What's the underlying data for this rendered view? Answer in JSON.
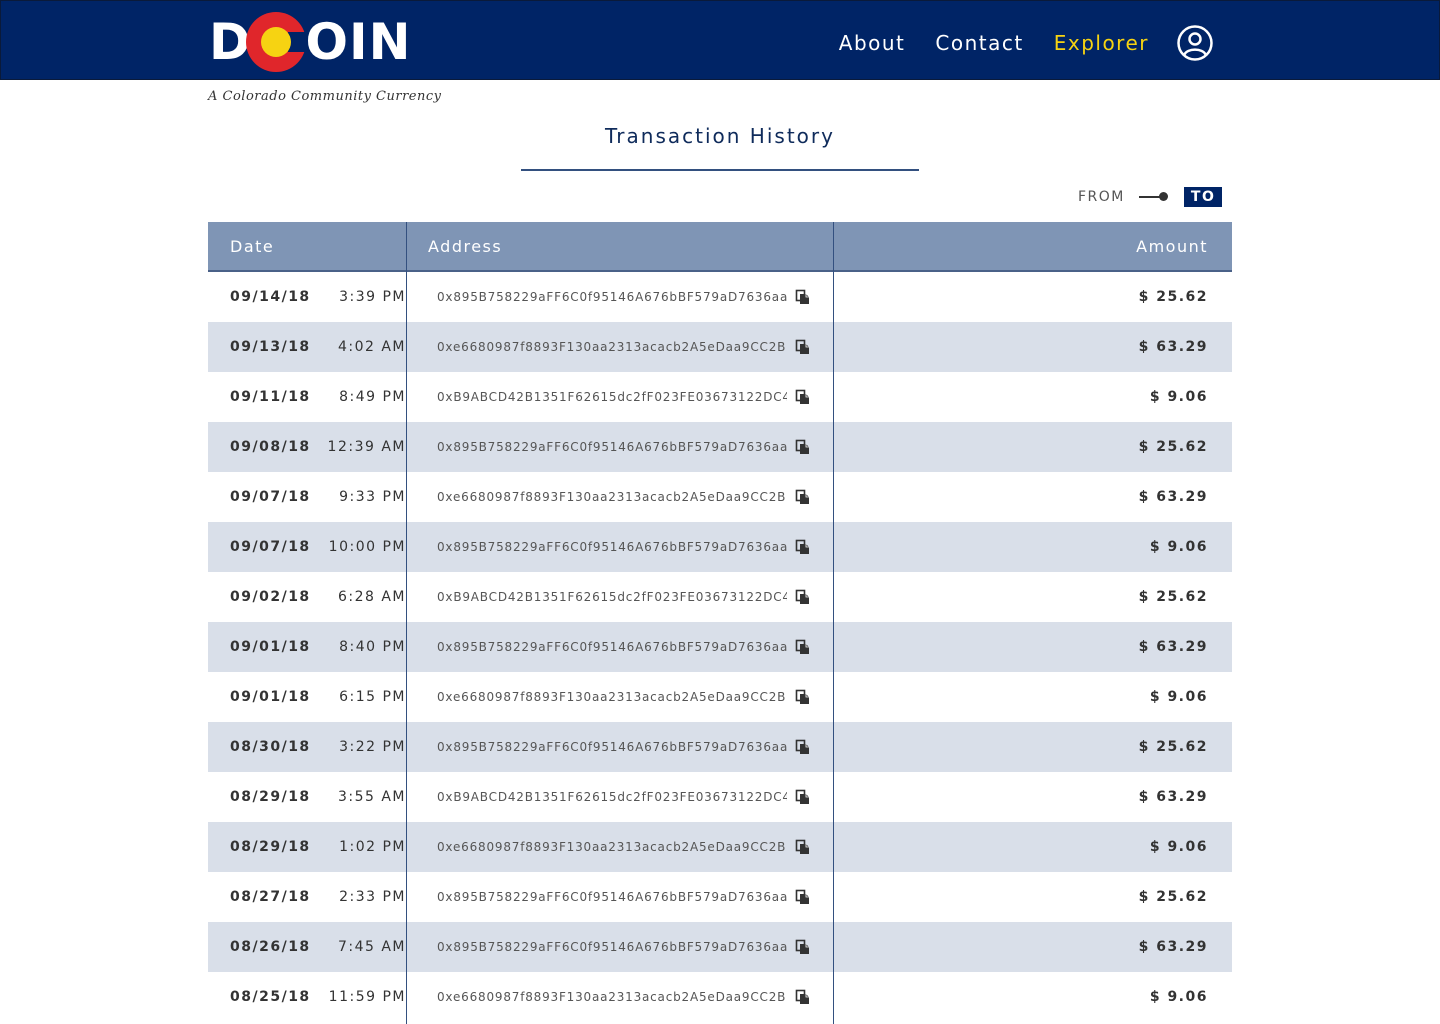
{
  "brand": {
    "logo_left": "D",
    "logo_right": "OIN",
    "tagline": "A Colorado Community Currency",
    "colors": {
      "navy": "#002466",
      "red": "#e0262b",
      "yellow": "#f6d312",
      "row_alt": "#d9dfe9",
      "header_row": "#7f95b5"
    }
  },
  "nav": {
    "items": [
      {
        "label": "About",
        "active": false
      },
      {
        "label": "Contact",
        "active": false
      },
      {
        "label": "Explorer",
        "active": true
      }
    ],
    "user_icon": "user-circle-icon"
  },
  "page": {
    "title": "Transaction History"
  },
  "toggle": {
    "from_label": "FROM",
    "to_label": "TO",
    "selected": "TO"
  },
  "table": {
    "columns": {
      "date": "Date",
      "address": "Address",
      "amount": "Amount"
    },
    "copy_icon": "copy-icon",
    "rows": [
      {
        "date": "09/14/18",
        "time": "3:39 PM",
        "address": "0x895B758229aFF6C0f95146A676bBF579aD7636aa",
        "amount": "$ 25.62"
      },
      {
        "date": "09/13/18",
        "time": "4:02 AM",
        "address": "0xe6680987f8893F130aa2313acacb2A5eDaa9CC2B",
        "amount": "$ 63.29"
      },
      {
        "date": "09/11/18",
        "time": "8:49 PM",
        "address": "0xB9ABCD42B1351F62615dc2fF023FE03673122DC4",
        "amount": "$ 9.06"
      },
      {
        "date": "09/08/18",
        "time": "12:39 AM",
        "address": "0x895B758229aFF6C0f95146A676bBF579aD7636aa",
        "amount": "$ 25.62"
      },
      {
        "date": "09/07/18",
        "time": "9:33 PM",
        "address": "0xe6680987f8893F130aa2313acacb2A5eDaa9CC2B",
        "amount": "$ 63.29"
      },
      {
        "date": "09/07/18",
        "time": "10:00 PM",
        "address": "0x895B758229aFF6C0f95146A676bBF579aD7636aa",
        "amount": "$ 9.06"
      },
      {
        "date": "09/02/18",
        "time": "6:28 AM",
        "address": "0xB9ABCD42B1351F62615dc2fF023FE03673122DC4",
        "amount": "$ 25.62"
      },
      {
        "date": "09/01/18",
        "time": "8:40 PM",
        "address": "0x895B758229aFF6C0f95146A676bBF579aD7636aa",
        "amount": "$ 63.29"
      },
      {
        "date": "09/01/18",
        "time": "6:15 PM",
        "address": "0xe6680987f8893F130aa2313acacb2A5eDaa9CC2B",
        "amount": "$ 9.06"
      },
      {
        "date": "08/30/18",
        "time": "3:22 PM",
        "address": "0x895B758229aFF6C0f95146A676bBF579aD7636aa",
        "amount": "$ 25.62"
      },
      {
        "date": "08/29/18",
        "time": "3:55 AM",
        "address": "0xB9ABCD42B1351F62615dc2fF023FE03673122DC4",
        "amount": "$ 63.29"
      },
      {
        "date": "08/29/18",
        "time": "1:02 PM",
        "address": "0xe6680987f8893F130aa2313acacb2A5eDaa9CC2B",
        "amount": "$ 9.06"
      },
      {
        "date": "08/27/18",
        "time": "2:33 PM",
        "address": "0x895B758229aFF6C0f95146A676bBF579aD7636aa",
        "amount": "$ 25.62"
      },
      {
        "date": "08/26/18",
        "time": "7:45 AM",
        "address": "0x895B758229aFF6C0f95146A676bBF579aD7636aa",
        "amount": "$ 63.29"
      },
      {
        "date": "08/25/18",
        "time": "11:59 PM",
        "address": "0xe6680987f8893F130aa2313acacb2A5eDaa9CC2B",
        "amount": "$ 9.06"
      }
    ]
  }
}
